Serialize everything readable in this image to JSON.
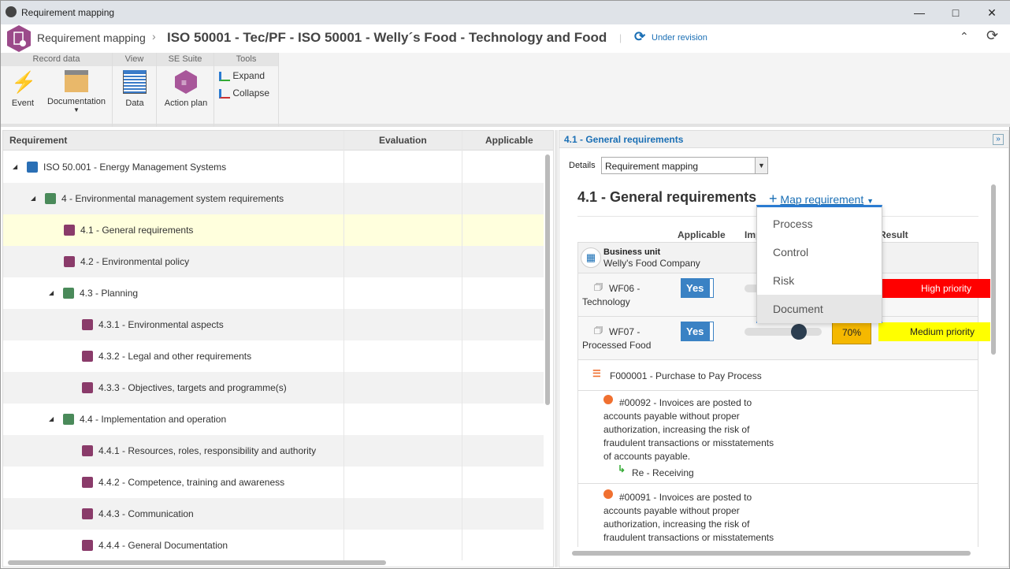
{
  "window": {
    "title": "Requirement mapping",
    "controls": [
      "minimize",
      "maximize",
      "close"
    ]
  },
  "header": {
    "module": "Requirement mapping",
    "record": "ISO 50001 - Tec/PF - ISO 50001 - Welly´s Food - Technology and Food",
    "status": "Under revision"
  },
  "ribbon": {
    "groups": [
      {
        "label": "Record data"
      },
      {
        "label": "View"
      },
      {
        "label": "SE Suite"
      },
      {
        "label": "Tools"
      }
    ],
    "event": "Event",
    "documentation": "Documentation",
    "data": "Data",
    "action_plan": "Action plan",
    "expand": "Expand",
    "collapse": "Collapse"
  },
  "tree": {
    "columns": [
      "Requirement",
      "Evaluation",
      "Applicable"
    ],
    "rows": [
      {
        "label": "ISO 50.001 - Energy Management Systems",
        "level": 0,
        "expanded": true,
        "icon": "hierarchy-icon"
      },
      {
        "label": "4 - Environmental management system requirements",
        "level": 1,
        "expanded": true,
        "icon": "group-icon"
      },
      {
        "label": "4.1 - General requirements",
        "level": 2,
        "icon": "requirement-icon",
        "selected": true
      },
      {
        "label": "4.2 - Environmental policy",
        "level": 2,
        "icon": "requirement-icon"
      },
      {
        "label": "4.3 - Planning",
        "level": 2,
        "expanded": true,
        "icon": "group-icon"
      },
      {
        "label": "4.3.1 - Environmental aspects",
        "level": 3,
        "icon": "requirement-icon"
      },
      {
        "label": "4.3.2 - Legal and other requirements",
        "level": 3,
        "icon": "requirement-icon"
      },
      {
        "label": "4.3.3 - Objectives, targets and programme(s)",
        "level": 3,
        "icon": "requirement-icon"
      },
      {
        "label": "4.4 - Implementation and operation",
        "level": 2,
        "expanded": true,
        "icon": "group-icon"
      },
      {
        "label": "4.4.1 - Resources, roles, responsibility and authority",
        "level": 3,
        "icon": "requirement-icon"
      },
      {
        "label": "4.4.2 - Competence, training and awareness",
        "level": 3,
        "icon": "requirement-icon"
      },
      {
        "label": "4.4.3 - Communication",
        "level": 3,
        "icon": "requirement-icon"
      },
      {
        "label": "4.4.4 - General Documentation",
        "level": 3,
        "icon": "requirement-icon"
      }
    ]
  },
  "detail": {
    "panel_title": "4.1 - General requirements",
    "details_label": "Details",
    "details_value": "Requirement mapping",
    "heading": "4.1 - General requirements",
    "map_requirement": "Map requirement",
    "menu": [
      "Process",
      "Control",
      "Risk",
      "Document"
    ],
    "menu_hover": "Document",
    "columns": {
      "applicable": "Applicable",
      "impact": "Imp",
      "result": "Result"
    },
    "business_unit_label": "Business unit",
    "business_unit": "Welly's Food Company",
    "items": [
      {
        "name": "WF06 - Technology",
        "applicable": "Yes",
        "result": "High priority",
        "result_color": "#ff0000"
      },
      {
        "name": "WF07 - Processed Food",
        "applicable": "Yes",
        "slider_percent": 70,
        "percent_label": "70%",
        "result": "Medium priority",
        "result_color": "#ffff00"
      }
    ],
    "process": "F000001 - Purchase to Pay Process",
    "risks": [
      {
        "text": "#00092 - Invoices are posted to accounts payable without proper authorization, increasing the risk of fraudulent transactions or misstatements of accounts payable.",
        "activity": "Re - Receiving"
      },
      {
        "text": "#00091 - Invoices are posted to accounts payable without proper authorization, increasing the risk of fraudulent transactions or misstatements"
      }
    ]
  },
  "colors": {
    "accent": "#1a6fb5",
    "module": "#9b4a8a",
    "menu_border": "#2a7bd1"
  }
}
